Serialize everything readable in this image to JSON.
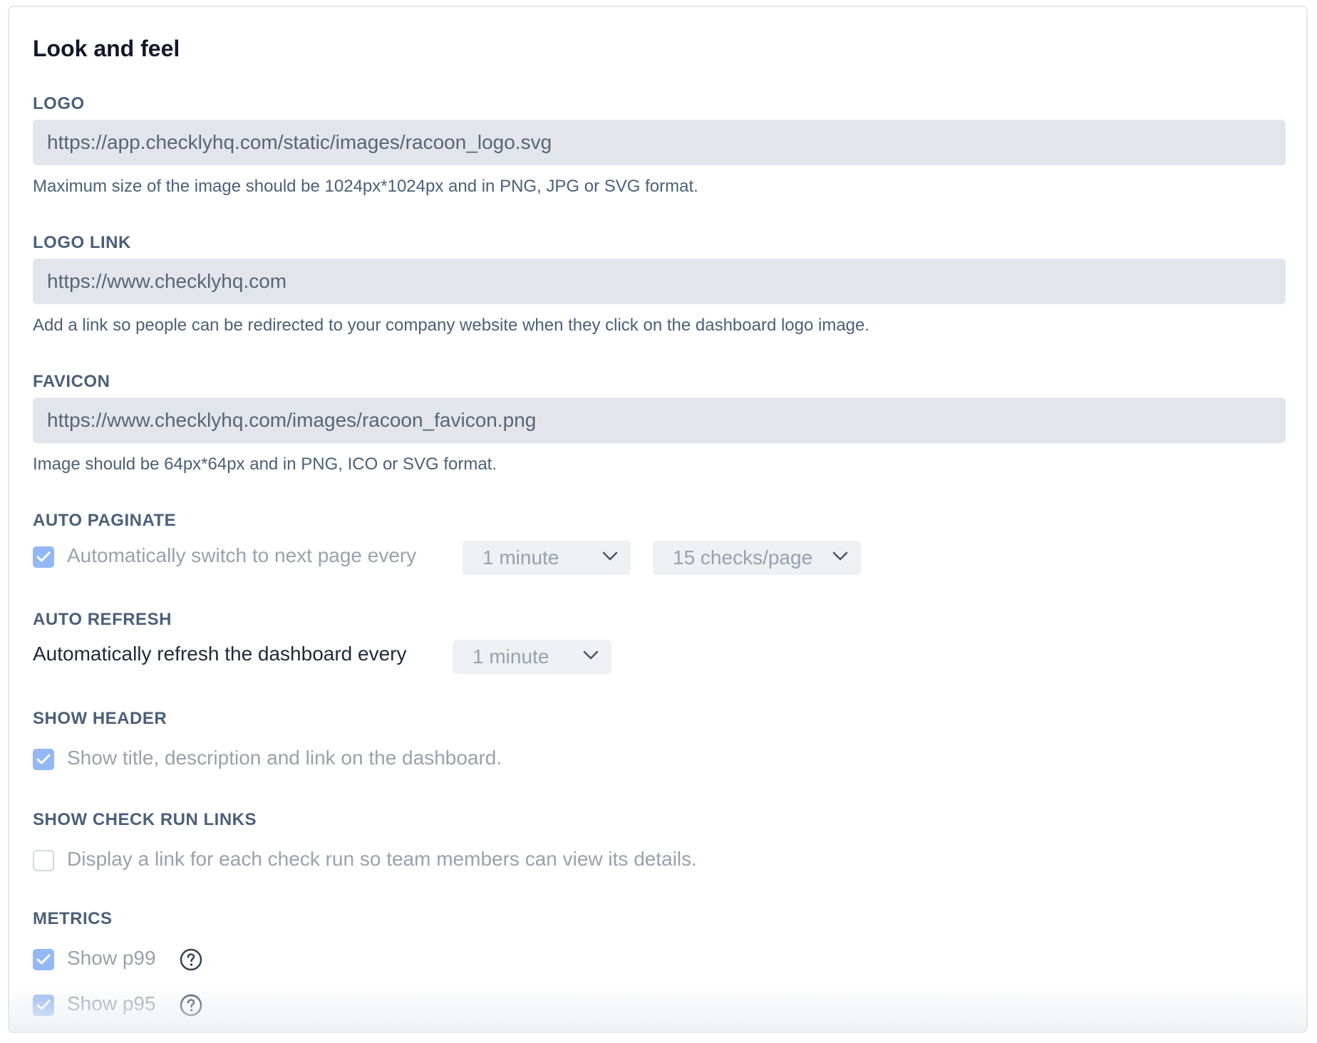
{
  "section_title": "Look and feel",
  "logo": {
    "label": "LOGO",
    "value": "https://app.checklyhq.com/static/images/racoon_logo.svg",
    "help": "Maximum size of the image should be 1024px*1024px and in PNG, JPG or SVG format."
  },
  "logo_link": {
    "label": "LOGO LINK",
    "value": "https://www.checklyhq.com",
    "help": "Add a link so people can be redirected to your company website when they click on the dashboard logo image."
  },
  "favicon": {
    "label": "FAVICON",
    "value": "https://www.checklyhq.com/images/racoon_favicon.png",
    "help": "Image should be 64px*64px and in PNG, ICO or SVG format."
  },
  "auto_paginate": {
    "label": "AUTO PAGINATE",
    "checked": true,
    "text": "Automatically switch to next page every",
    "interval": "1 minute",
    "per_page": "15 checks/page"
  },
  "auto_refresh": {
    "label": "AUTO REFRESH",
    "text": "Automatically refresh the dashboard every",
    "interval": "1 minute"
  },
  "show_header": {
    "label": "SHOW HEADER",
    "checked": true,
    "text": "Show title, description and link on the dashboard."
  },
  "show_check_run_links": {
    "label": "SHOW CHECK RUN LINKS",
    "checked": false,
    "text": "Display a link for each check run so team members can view its details."
  },
  "metrics": {
    "label": "METRICS",
    "items": [
      {
        "text": "Show p99",
        "checked": true
      },
      {
        "text": "Show p95",
        "checked": true
      }
    ]
  },
  "colors": {
    "checkbox_checked": "#93b8f5",
    "input_bg": "#e2e6ec",
    "label": "#4b5f78"
  }
}
